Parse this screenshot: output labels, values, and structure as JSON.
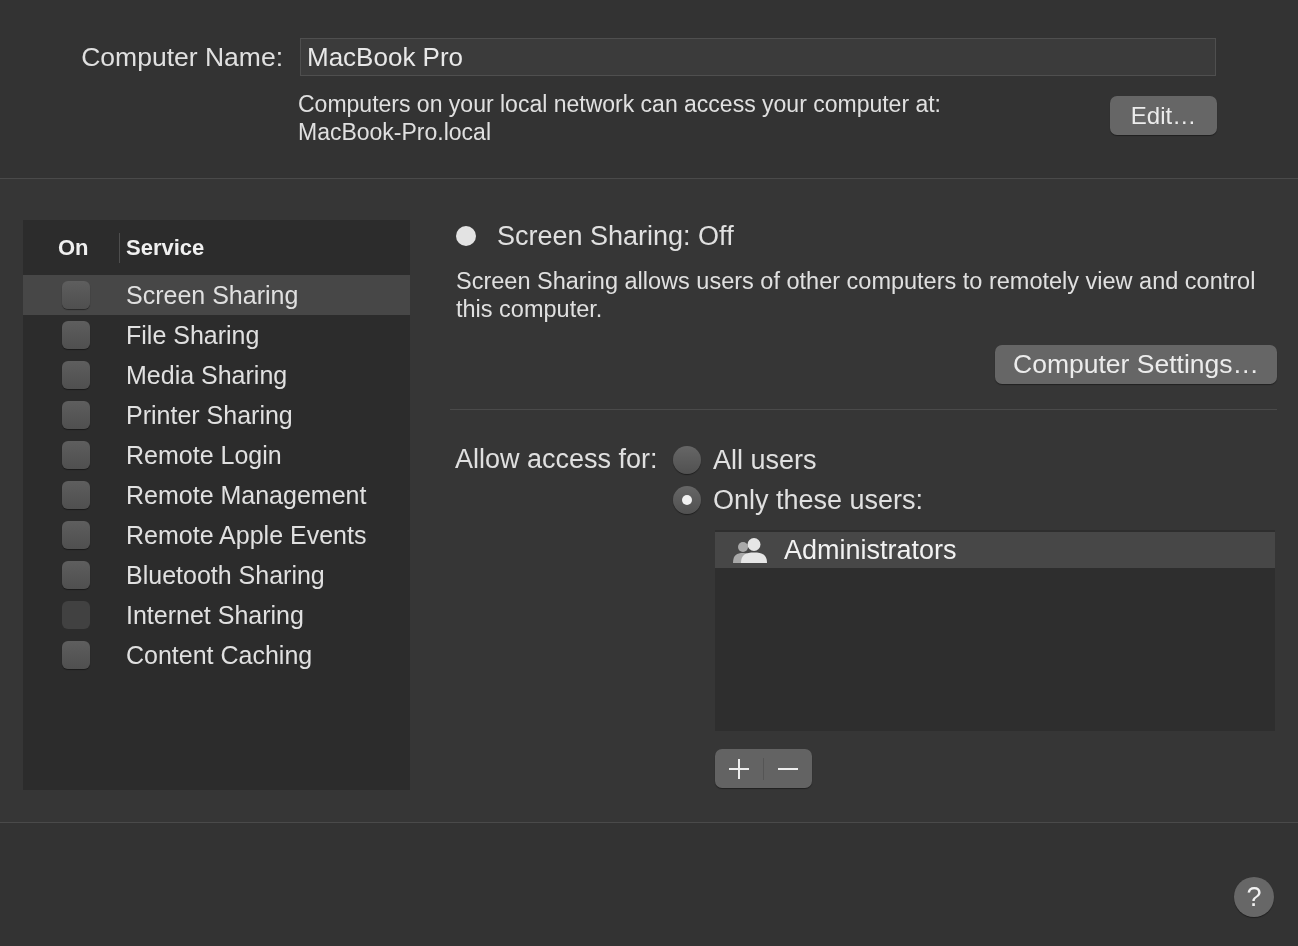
{
  "computer_name": {
    "label": "Computer Name:",
    "value": "MacBook Pro"
  },
  "network_note": {
    "text": "Computers on your local network can access your computer at:",
    "address": "MacBook-Pro.local"
  },
  "edit_button": "Edit…",
  "services_table": {
    "columns": [
      "On",
      "Service"
    ],
    "rows": [
      {
        "name": "Screen Sharing",
        "checked": false,
        "disabled": false,
        "selected": true
      },
      {
        "name": "File Sharing",
        "checked": false,
        "disabled": false,
        "selected": false
      },
      {
        "name": "Media Sharing",
        "checked": false,
        "disabled": false,
        "selected": false
      },
      {
        "name": "Printer Sharing",
        "checked": false,
        "disabled": false,
        "selected": false
      },
      {
        "name": "Remote Login",
        "checked": false,
        "disabled": false,
        "selected": false
      },
      {
        "name": "Remote Management",
        "checked": false,
        "disabled": false,
        "selected": false
      },
      {
        "name": "Remote Apple Events",
        "checked": false,
        "disabled": false,
        "selected": false
      },
      {
        "name": "Bluetooth Sharing",
        "checked": false,
        "disabled": false,
        "selected": false
      },
      {
        "name": "Internet Sharing",
        "checked": false,
        "disabled": true,
        "selected": false
      },
      {
        "name": "Content Caching",
        "checked": false,
        "disabled": false,
        "selected": false
      }
    ]
  },
  "service_status": {
    "on": false,
    "title": "Screen Sharing: Off",
    "description": "Screen Sharing allows users of other computers to remotely view and control this computer."
  },
  "computer_settings_button": "Computer Settings…",
  "access": {
    "label": "Allow access for:",
    "options": [
      {
        "label": "All users",
        "selected": false
      },
      {
        "label": "Only these users:",
        "selected": true
      }
    ],
    "users": [
      {
        "name": "Administrators",
        "selected": true
      }
    ]
  },
  "help_button": "?"
}
